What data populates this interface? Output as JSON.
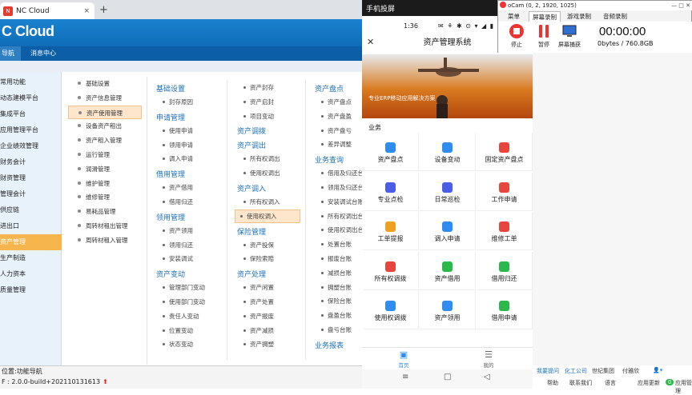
{
  "browser": {
    "tab_title": "NC Cloud",
    "close": "×",
    "new_tab": "+"
  },
  "nc": {
    "logo": "C Cloud",
    "menu": [
      "导航",
      "消息中心"
    ],
    "left_nav": [
      "常用功能",
      "动态建模平台",
      "集成平台",
      "应用管理平台",
      "企业绩效管理",
      "财务会计",
      "财资管理",
      "管理会计",
      "供应链",
      "进出口",
      "资产管理",
      "生产制造",
      "人力资本",
      "质量管理"
    ],
    "left_nav_active": "资产管理",
    "categories": [
      "基础设置",
      "资产信息管理",
      "资产使用管理",
      "设备资产租出",
      "资产租入管理",
      "运行管理",
      "润滑管理",
      "维护管理",
      "维修管理",
      "易耗品管理",
      "周转材租出管理",
      "周转材租入管理"
    ],
    "category_active": "资产使用管理",
    "col1": [
      {
        "group": "基础设置",
        "items": [
          "封存原因"
        ]
      },
      {
        "group": "申请管理",
        "items": [
          "使用申请",
          "领用申请",
          "调入申请"
        ]
      },
      {
        "group": "借用管理",
        "items": [
          "资产借用",
          "借用归还"
        ]
      },
      {
        "group": "领用管理",
        "items": [
          "资产领用",
          "领用归还",
          "安装调试"
        ]
      },
      {
        "group": "资产变动",
        "items": [
          "管理部门变动",
          "使用部门变动",
          "责任人变动",
          "位置变动",
          "状态变动"
        ]
      }
    ],
    "col2": [
      {
        "group": "",
        "items": [
          "资产封存",
          "资产启封",
          "项目变动"
        ]
      },
      {
        "group": "资产调拨",
        "items": []
      },
      {
        "group": "资产调出",
        "items": [
          "所有权调出",
          "使用权调出"
        ]
      },
      {
        "group": "资产调入",
        "items": [
          "所有权调入",
          "使用权调入"
        ]
      },
      {
        "group": "保险管理",
        "items": [
          "资产投保",
          "保险索赔"
        ]
      },
      {
        "group": "资产处理",
        "items": [
          "资产闲置",
          "资产处置",
          "资产报废",
          "资产减损",
          "资产拥塑"
        ]
      }
    ],
    "col2_highlight": "使用权调入",
    "col3": [
      {
        "group": "资产盘点",
        "items": [
          "资产盘点",
          "资产盘盈",
          "资产盘亏",
          "差异调整"
        ]
      },
      {
        "group": "业务查询",
        "items": [
          "借用及归还台账",
          "领用及归还台账",
          "安装调试台账",
          "所有权调出台账",
          "使用权调出台账",
          "处置台账",
          "报废台账",
          "减损台账",
          "拥塑台账",
          "保险台账",
          "盘盈台账",
          "盘亏台账"
        ]
      },
      {
        "group": "业务报表",
        "items": []
      }
    ],
    "status_line1": "位置:功能导航",
    "status_line2": "F : 2.0.0-build+202110131613",
    "status_warn": "⬆"
  },
  "phone": {
    "window_title": "手机投屏",
    "time": "1:36",
    "status_icons": "✉ ⚘ ✱ ⊙ ▾ ◢ ▮",
    "app_title": "资产管理系统",
    "close": "✕",
    "more": "⋯",
    "banner_text": "专业ERP移动应用解决方案",
    "section": "业务",
    "tiles": [
      {
        "label": "资产盘点",
        "color": "#2f8cf0"
      },
      {
        "label": "设备变动",
        "color": "#2f8cf0"
      },
      {
        "label": "固定资产盘点",
        "color": "#e8453c"
      },
      {
        "label": "专业点检",
        "color": "#4b5ee8"
      },
      {
        "label": "日常巡检",
        "color": "#4b5ee8"
      },
      {
        "label": "工作申请",
        "color": "#e8453c"
      },
      {
        "label": "工单提报",
        "color": "#f0a020"
      },
      {
        "label": "调入申请",
        "color": "#2f8cf0"
      },
      {
        "label": "维修工单",
        "color": "#e8453c"
      },
      {
        "label": "所有权调拨",
        "color": "#e8453c"
      },
      {
        "label": "资产借用",
        "color": "#2cb94c"
      },
      {
        "label": "借用归还",
        "color": "#2cb94c"
      },
      {
        "label": "使用权调拨",
        "color": "#2f8cf0"
      },
      {
        "label": "资产领用",
        "color": "#2f8cf0"
      },
      {
        "label": "借用申请",
        "color": "#2cb94c"
      }
    ],
    "tab_home": "首页",
    "tab_mine": "我的",
    "nav_menu": "≡",
    "nav_home": "□",
    "nav_back": "◁"
  },
  "ocam": {
    "title": "oCam (0, 2, 1920, 1025)",
    "win_buttons": "— □ ✕",
    "tabs": [
      "菜单",
      "屏幕录制",
      "游戏录制",
      "音频录制"
    ],
    "active_tab": "屏幕录制",
    "btn_stop": "停止",
    "btn_pause": "暂停",
    "btn_capture": "屏幕捕获",
    "time": "00:00:00",
    "size": "0bytes / 760.8GB"
  },
  "right": {
    "links": [
      "我要提问",
      "化工公司",
      "世纪集团",
      "付雅欣"
    ],
    "bottom": [
      "帮助",
      "联系我们",
      "语言",
      "应用更新",
      "应用管理"
    ],
    "badge": "0"
  }
}
